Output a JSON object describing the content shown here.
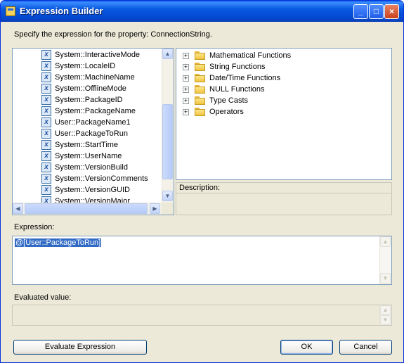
{
  "window": {
    "title": "Expression Builder",
    "minimize_glyph": "_",
    "maximize_glyph": "□",
    "close_glyph": "×"
  },
  "prompt": "Specify the expression for the property: ConnectionString.",
  "variables": {
    "icon_glyph": "x",
    "items": [
      "System::InteractiveMode",
      "System::LocaleID",
      "System::MachineName",
      "System::OfflineMode",
      "System::PackageID",
      "System::PackageName",
      "User::PackageName1",
      "User::PackageToRun",
      "System::StartTime",
      "System::UserName",
      "System::VersionBuild",
      "System::VersionComments",
      "System::VersionGUID",
      "System::VersionMajor"
    ]
  },
  "functions": {
    "expander_glyph": "+",
    "items": [
      "Mathematical Functions",
      "String Functions",
      "Date/Time Functions",
      "NULL Functions",
      "Type Casts",
      "Operators"
    ]
  },
  "description": {
    "label": "Description:",
    "value": ""
  },
  "expression": {
    "label": "Expression:",
    "value": "@[User::PackageToRun]"
  },
  "evaluated": {
    "label": "Evaluated value:",
    "value": ""
  },
  "buttons": {
    "evaluate": "Evaluate Expression",
    "ok": "OK",
    "cancel": "Cancel"
  },
  "scroll": {
    "up": "▲",
    "down": "▼",
    "left": "◀",
    "right": "▶"
  }
}
